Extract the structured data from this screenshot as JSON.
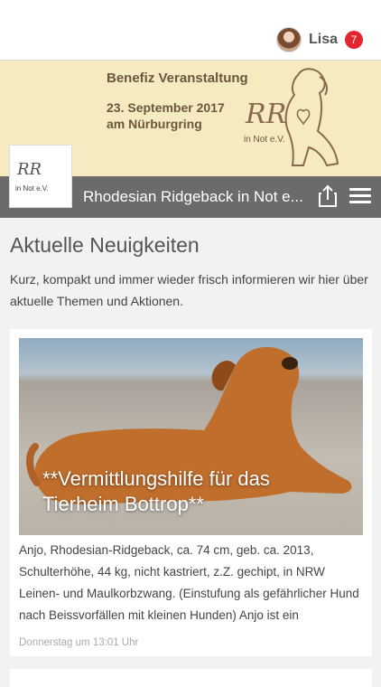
{
  "user": {
    "name": "Lisa",
    "notifications": "7"
  },
  "banner": {
    "title": "Benefiz Veranstaltung",
    "date": "23. September 2017",
    "location": "am Nürburgring",
    "org": "in Not e.V.",
    "monogram": "RR"
  },
  "app": {
    "title": "Rhodesian Ridgeback in Not e...",
    "logo_text": "in Not e.V.",
    "logo_monogram": "RR"
  },
  "section": {
    "heading": "Aktuelle Neuigkeiten",
    "intro": "Kurz, kompakt und immer wieder frisch informieren wir hier über aktuelle Themen und Aktionen."
  },
  "post": {
    "title": "**Vermittlungshilfe für das Tierheim Bottrop**",
    "excerpt": "Anjo, Rhodesian-Ridgeback, ca. 74 cm, geb. ca. 2013, Schulterhöhe, 44 kg, nicht kastriert, z.Z. gechipt, in NRW Leinen- und Maulkorbzwang. (Einstufung als gefährlicher Hund nach Beissvorfällen mit kleinen Hunden) Anjo ist ein",
    "date": "Donnerstag um 13:01 Uhr"
  },
  "colors": {
    "titlebar": "#6b6b6b",
    "banner": "#f6ebc0",
    "badge": "#e3262e"
  }
}
